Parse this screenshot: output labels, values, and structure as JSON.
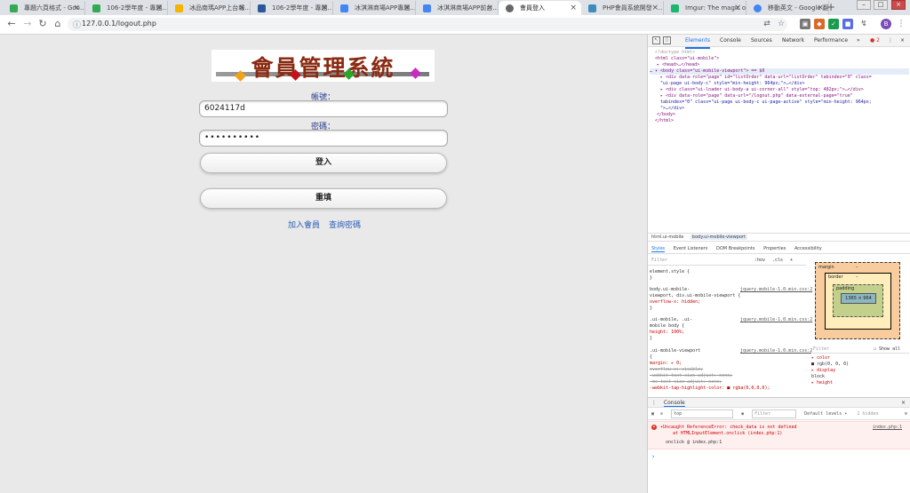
{
  "browser": {
    "tabs": [
      {
        "title": "專題六頁格式 - Goo…",
        "icon_color": "#34a853"
      },
      {
        "title": "106-2學年度 - 專題…",
        "icon_color": "#34a853"
      },
      {
        "title": "冰品南瑪APP上台報…",
        "icon_color": "#f4b400"
      },
      {
        "title": "106-2學年度 - 專題…",
        "icon_color": "#2b579a"
      },
      {
        "title": "冰淇淋商場APP專題…",
        "icon_color": "#4285f4"
      },
      {
        "title": "冰淇淋商場APP前台…",
        "icon_color": "#4285f4"
      },
      {
        "title": "會員登入",
        "icon_color": "#666666"
      },
      {
        "title": "PHP會員系統開發 - …",
        "icon_color": "#3c8dbc"
      },
      {
        "title": "Imgur: The magic of …",
        "icon_color": "#1bb76e"
      },
      {
        "title": "移動英文 - Google 翻…",
        "icon_color": "#4285f4"
      }
    ],
    "url": "127.0.0.1/logout.php",
    "avatar_letter": "B"
  },
  "page": {
    "banner_text": "會員管理系統",
    "account_label": "帳號：",
    "account_value": "6024117d",
    "password_label": "密碼：",
    "password_value": "••••••••••",
    "login_button": "登入",
    "reset_button": "重填",
    "join_link": "加入會員",
    "forgot_link": "查詢密碼"
  },
  "devtools": {
    "tabs": [
      "Elements",
      "Console",
      "Sources",
      "Network",
      "Performance"
    ],
    "more": "»",
    "error_count": "2",
    "dom_lines": [
      "<!doctype html>",
      "<html class=\"ui-mobile\">",
      "▸ <head>…</head>",
      "… ▾ <body class=\"ui-mobile-viewport\"> == $0",
      "▸ <div data-role=\"page\" id=\"listOrder\" data-url=\"listOrder\" tabindex=\"0\" class=",
      "\"ui-page ui-body-c\" style=\"min-height: 964px;\">…</div>",
      "▸ <div class=\"ui-loader ui-body-a ui-corner-all\" style=\"top: 482px;\">…</div>",
      "▸ <div data-role=\"page\" data-url=\"/logout.php\" data-external-page=\"true\"",
      "tabindex=\"0\" class=\"ui-page ui-body-c ui-page-active\" style=\"min-height: 964px;",
      "\">…</div>",
      "</body>",
      "</html>"
    ],
    "breadcrumbs": [
      "html.ui-mobile",
      "body.ui-mobile-viewport"
    ],
    "subtabs": [
      "Styles",
      "Event Listeners",
      "DOM Breakpoints",
      "Properties",
      "Accessibility"
    ],
    "filter_placeholder": "Filter",
    "hov": ":hov",
    "cls": ".cls",
    "styles": [
      {
        "selector": "element.style {",
        "src": "",
        "props": [
          "}"
        ]
      },
      {
        "selector": "body.ui-mobile-",
        "src": "jquery.mobile-1.0.min.css:2",
        "props": [
          "viewport, div.ui-mobile-viewport {",
          "  overflow-x: hidden;",
          "}"
        ]
      },
      {
        "selector": ".ui-mobile, .ui-",
        "src": "jquery.mobile-1.0.min.css:2",
        "props": [
          "mobile body {",
          "  height: 100%;",
          "}"
        ]
      },
      {
        "selector": ".ui-mobile-viewport",
        "src": "jquery.mobile-1.0.min.css:2",
        "props": [
          "{",
          "  margin: ▸ 0;",
          "  overflow-x: visible;",
          "  -webkit-text-size-adjust: none;",
          "  -ms-text-size-adjust: none;",
          "  -webkit-tap-highlight-color: ■ rgba(0,0,0,0);"
        ]
      }
    ],
    "box_model": {
      "margin": "margin",
      "border": "border",
      "padding": "padding",
      "content": "1365 × 964",
      "dash": "–"
    },
    "computed_filter": "Filter",
    "show_all": "Show all",
    "computed": [
      "▸ color",
      "  ■ rgb(0, 0, 0)",
      "▸ display",
      "  block",
      "▸ height"
    ],
    "console": {
      "title": "Console",
      "context": "top",
      "filter": "Filter",
      "levels": "Default levels ▾",
      "hidden": "1 hidden",
      "error_text": "▾Uncaught ReferenceError: check_data is not defined",
      "error_at": "at HTMLInputElement.onclick (index.php:1)",
      "error_src": "index.php:1",
      "onclick": "onclick @ index.php:1",
      "prompt": "›"
    }
  }
}
